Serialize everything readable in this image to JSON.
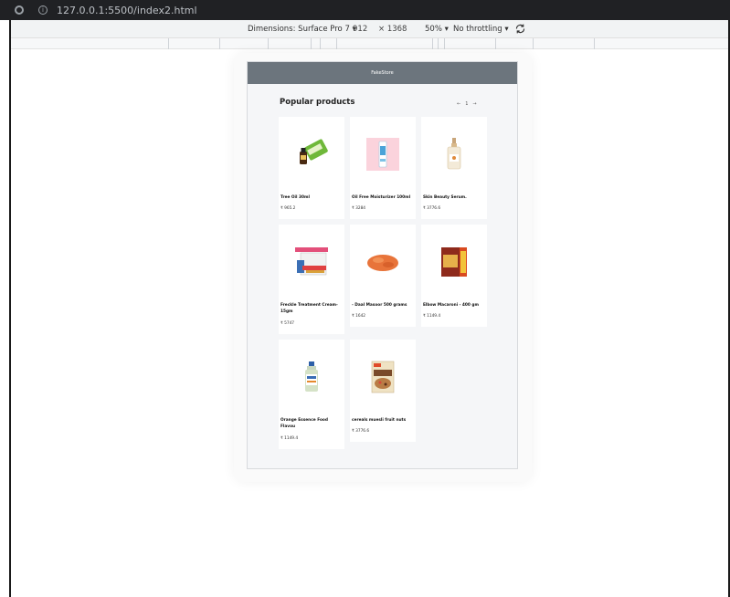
{
  "browser": {
    "url": "127.0.0.1:5500/index2.html"
  },
  "devtools": {
    "dimensions_label": "Dimensions: Surface Pro 7 ▾",
    "width": "912",
    "height_label": "× 1368",
    "zoom_label": "50% ▾",
    "throttle_label": "No throttling ▾"
  },
  "site": {
    "header_title": "FakeStore",
    "section_title": "Popular products",
    "pager": {
      "prev": "←",
      "page": "1",
      "next": "→"
    },
    "products": [
      {
        "name": "Tree Oil 30ml",
        "price": "₹ 965.2"
      },
      {
        "name": "Oil Free Moisturizer 100ml",
        "price": "₹ 3284"
      },
      {
        "name": "Skin Beauty Serum.",
        "price": "₹ 3776.6"
      },
      {
        "name": "Freckle Treatment Cream- 15gm",
        "price": "₹ 5747"
      },
      {
        "name": "- Daal Masoor 500 grams",
        "price": "₹ 1642"
      },
      {
        "name": "Elbow Macaroni - 400 gm",
        "price": "₹ 1149.4"
      },
      {
        "name": "Orange Essence Food Flavou",
        "price": "₹ 1149.4"
      },
      {
        "name": "cereals muesli fruit nuts",
        "price": "₹ 3776.6"
      }
    ]
  }
}
